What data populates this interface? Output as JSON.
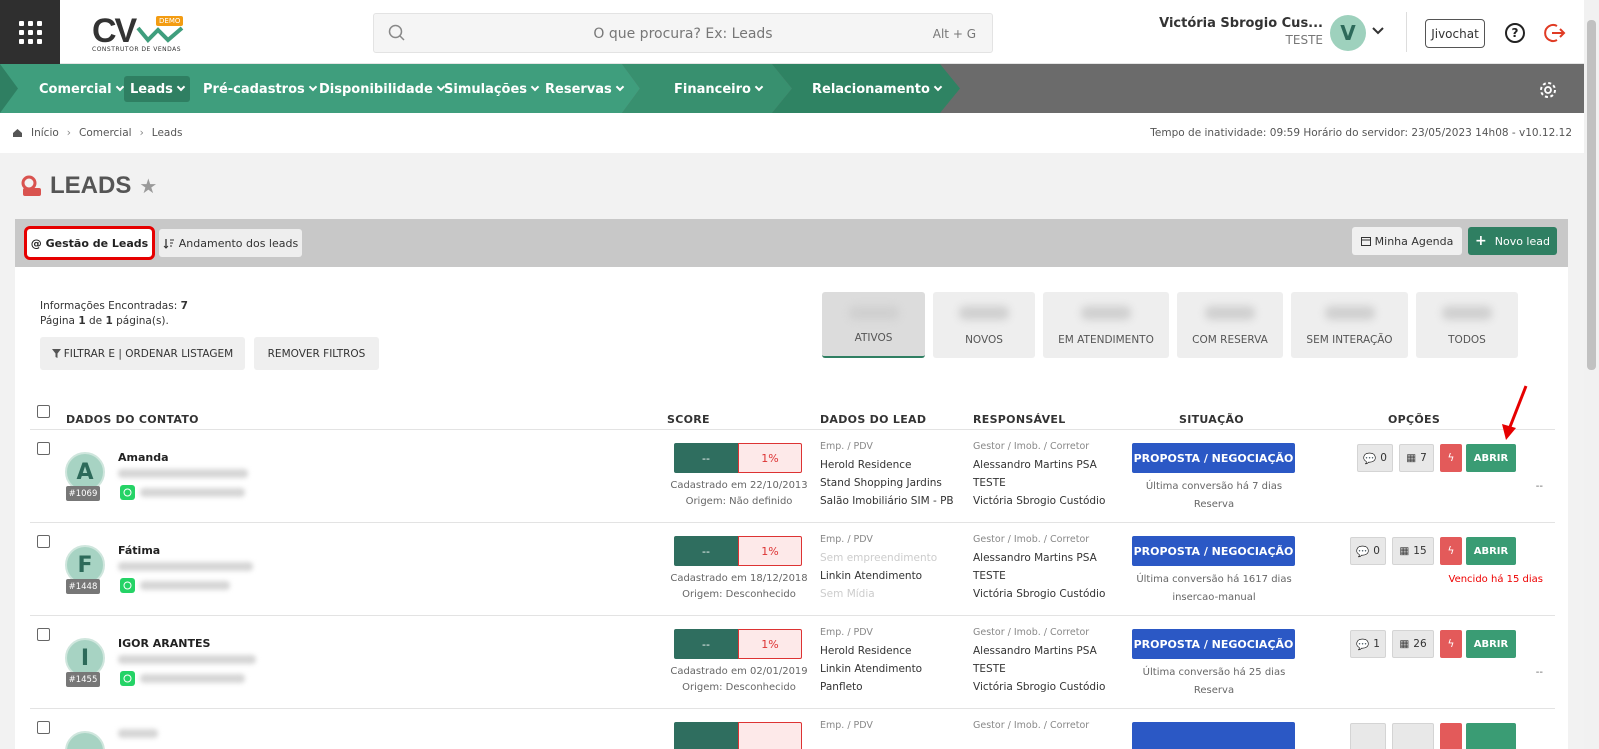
{
  "header": {
    "logo": {
      "text": "CV",
      "badge": "DEMO",
      "subtitle": "CONSTRUTOR DE VENDAS"
    },
    "search_placeholder": "O que procura? Ex: Leads",
    "search_shortcut": "Alt + G",
    "user_name": "Victória Sbrogio Cus...",
    "user_role": "TESTE",
    "user_initial": "V",
    "jivochat_label": "Jivochat"
  },
  "nav": {
    "items": [
      "Comercial",
      "Leads",
      "Pré-cadastros",
      "Disponibilidade",
      "Simulações",
      "Reservas",
      "Financeiro",
      "Relacionamento"
    ],
    "active": "Leads"
  },
  "breadcrumb": [
    "Início",
    "Comercial",
    "Leads"
  ],
  "server_info": "Tempo de inatividade: 09:59   Horário do servidor: 23/05/2023 14h08 - v10.12.12",
  "page_title": "LEADS",
  "toolbar": {
    "tab_gestao": "@ Gestão de Leads",
    "tab_andamento": "Andamento dos leads",
    "agenda": "Minha Agenda",
    "novo_lead": "Novo lead"
  },
  "info": {
    "found_label": "Informações Encontradas:",
    "found_count": "7",
    "page_text_pre": "Página",
    "page_num": "1",
    "page_of": "de",
    "page_total": "1",
    "page_suffix": "página(s)."
  },
  "filters": {
    "filter": "FILTRAR E | ORDENAR LISTAGEM",
    "remove": "REMOVER FILTROS"
  },
  "status_tabs": [
    "ATIVOS",
    "NOVOS",
    "EM ATENDIMENTO",
    "COM RESERVA",
    "SEM INTERAÇÃO",
    "TODOS"
  ],
  "columns": [
    "DADOS DO CONTATO",
    "SCORE",
    "DADOS DO LEAD",
    "RESPONSÁVEL",
    "SITUAÇÃO",
    "OPÇÕES"
  ],
  "rows": [
    {
      "initial": "A",
      "id": "#1069",
      "name": "Amanda",
      "score_a": "--",
      "score_b": "1%",
      "cadastrado": "Cadastrado em 22/10/2013",
      "origem": "Origem: Não definido",
      "lead_cap": "Emp. / PDV",
      "lead_1": "Herold Residence",
      "lead_2": "Stand Shopping Jardins",
      "lead_3": "Salão Imobiliário SIM - PB",
      "resp_cap": "Gestor / Imob. / Corretor",
      "resp_1": "Alessandro Martins PSA",
      "resp_2": "TESTE",
      "resp_3": "Victória Sbrogio Custódio",
      "situacao": "PROPOSTA / NEGOCIAÇÃO",
      "sit_1": "Última conversão há 7 dias",
      "sit_2": "Reserva",
      "msgs": "0",
      "agenda": "7",
      "abrir": "ABRIR",
      "opt_sub": "--"
    },
    {
      "initial": "F",
      "id": "#1448",
      "name": "Fátima",
      "score_a": "--",
      "score_b": "1%",
      "cadastrado": "Cadastrado em 18/12/2018",
      "origem": "Origem: Desconhecido",
      "lead_cap": "Emp. / PDV",
      "lead_1": "Sem empreendimento",
      "lead_2": "Linkin Atendimento",
      "lead_3": "Sem Mídia",
      "resp_cap": "Gestor / Imob. / Corretor",
      "resp_1": "Alessandro Martins PSA",
      "resp_2": "TESTE",
      "resp_3": "Victória Sbrogio Custódio",
      "situacao": "PROPOSTA / NEGOCIAÇÃO",
      "sit_1": "Última conversão há 1617 dias",
      "sit_2": "insercao-manual",
      "msgs": "0",
      "agenda": "15",
      "abrir": "ABRIR",
      "opt_sub": "Vencido há 15 dias"
    },
    {
      "initial": "I",
      "id": "#1455",
      "name": "IGOR ARANTES",
      "score_a": "--",
      "score_b": "1%",
      "cadastrado": "Cadastrado em 02/01/2019",
      "origem": "Origem: Desconhecido",
      "lead_cap": "Emp. / PDV",
      "lead_1": "Herold Residence",
      "lead_2": "Linkin Atendimento",
      "lead_3": "Panfleto",
      "resp_cap": "Gestor / Imob. / Corretor",
      "resp_1": "Alessandro Martins PSA",
      "resp_2": "TESTE",
      "resp_3": "Victória Sbrogio Custódio",
      "situacao": "PROPOSTA / NEGOCIAÇÃO",
      "sit_1": "Última conversão há 25 dias",
      "sit_2": "Reserva",
      "msgs": "1",
      "agenda": "26",
      "abrir": "ABRIR",
      "opt_sub": "--"
    },
    {
      "lead_cap": "Emp. / PDV",
      "resp_cap": "Gestor / Imob. / Corretor"
    }
  ],
  "colors": {
    "green": "#3f9e7d",
    "dark_green": "#2f7f62",
    "blue": "#2b58c5",
    "red": "#e35a5a",
    "highlight": "#e60000"
  }
}
